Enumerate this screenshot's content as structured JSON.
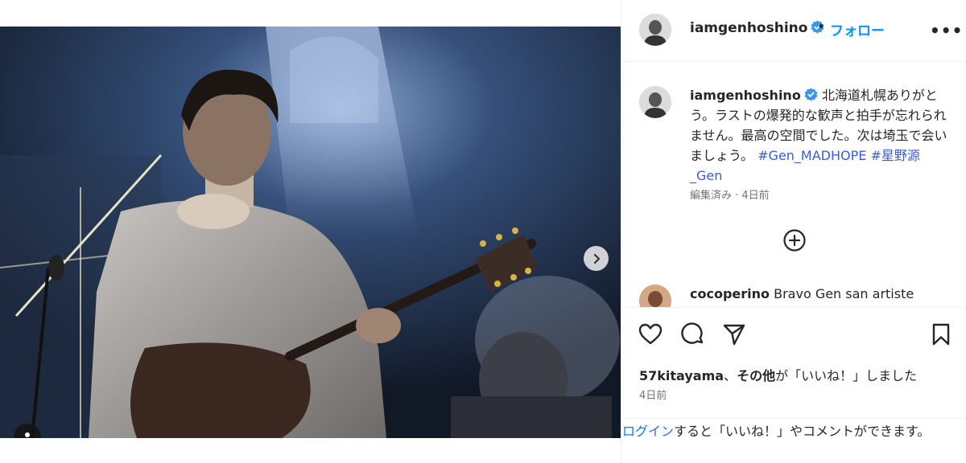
{
  "post": {
    "username": "iamgenhoshino",
    "separator": "•",
    "follow_label": "フォロー",
    "more_label": "•••",
    "caption_text": "北海道札幌ありがとう。ラストの爆発的な歓声と拍手が忘れられません。最高の空間でした。次は埼玉で会いましょう。",
    "hashtags": "#Gen_MADHOPE #星野源_Gen",
    "caption_meta": "編集済み · 4日前",
    "comment_user": "cocoperino",
    "comment_text": "Bravo Gen san artiste",
    "likes_user": "57kitayama",
    "likes_mid": "、",
    "likes_others": "その他",
    "likes_suffix": "が「いいね！」しました",
    "time": "4日前",
    "login_link": "ログイン",
    "login_text": "すると「いいね！」やコメントができます。"
  },
  "media": {
    "page_index": 1,
    "page_count": 2
  },
  "colors": {
    "accent": "#0095f6",
    "verified": "#3897f0",
    "text": "#262626",
    "muted": "#737373"
  },
  "icons": [
    "verified-badge-icon",
    "more-options-icon",
    "add-comment-icon",
    "heart-icon",
    "comment-icon",
    "share-icon",
    "bookmark-icon",
    "chevron-right-icon",
    "user-tag-icon"
  ]
}
